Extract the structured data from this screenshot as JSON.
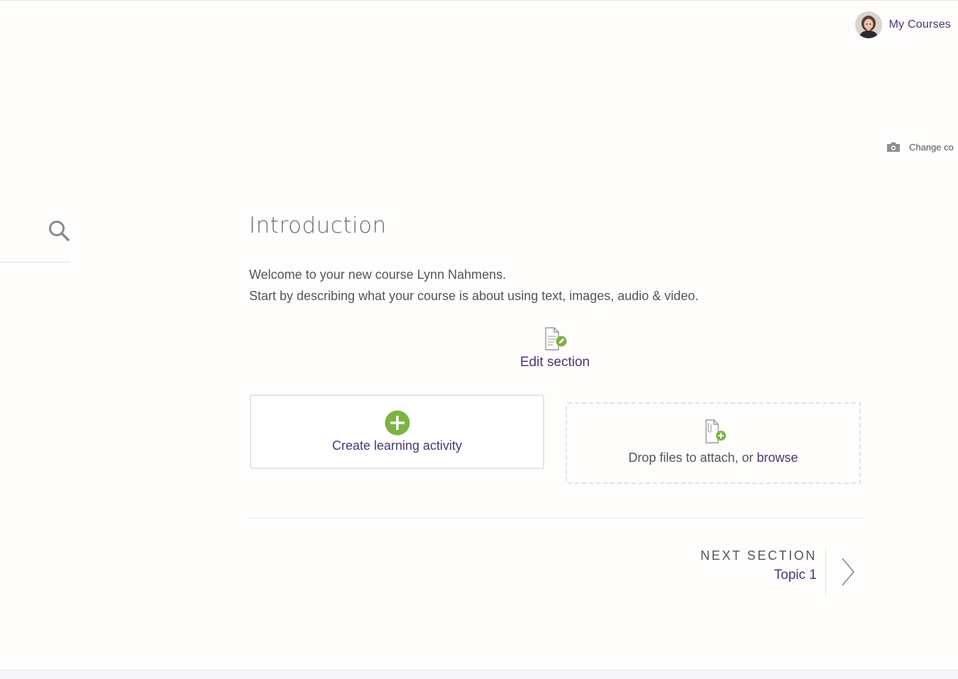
{
  "header": {
    "user_menu_label": "My Courses",
    "change_cover_label": "Change co"
  },
  "section": {
    "title": "Introduction",
    "summary_lines": [
      "Welcome to your new course Lynn Nahmens.",
      "Start by describing what your course is about using text, images, audio & video."
    ],
    "edit_label": "Edit section"
  },
  "actions": {
    "create_label": "Create learning activity",
    "drop_prefix": "Drop files to attach, or ",
    "drop_browse": "browse"
  },
  "navigation": {
    "next_caption": "Next Section",
    "next_topic": "Topic 1"
  },
  "colors": {
    "link": "#4a3673",
    "accent_green": "#7cb342",
    "text": "#555555"
  }
}
